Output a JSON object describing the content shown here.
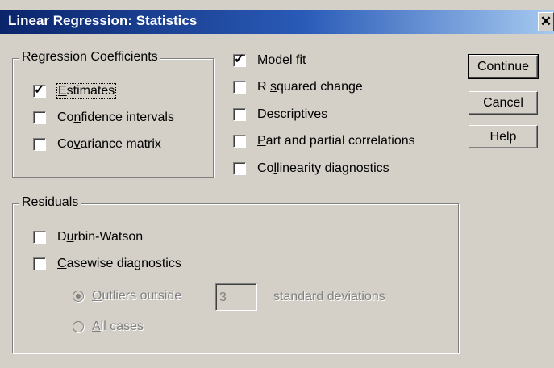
{
  "window": {
    "title": "Linear Regression: Statistics",
    "close_glyph": "✕"
  },
  "regression_coefficients": {
    "label": "Regression Coefficients",
    "estimates": {
      "pre": "",
      "u": "E",
      "post": "stimates",
      "checked": true
    },
    "confidence_intervals": {
      "pre": "Co",
      "u": "n",
      "post": "fidence intervals",
      "checked": false
    },
    "covariance_matrix": {
      "pre": "Co",
      "u": "v",
      "post": "ariance matrix",
      "checked": false
    }
  },
  "model_options": {
    "model_fit": {
      "pre": "",
      "u": "M",
      "post": "odel fit",
      "checked": true
    },
    "r_squared_change": {
      "pre": "R ",
      "u": "s",
      "post": "quared change",
      "checked": false
    },
    "descriptives": {
      "pre": "",
      "u": "D",
      "post": "escriptives",
      "checked": false
    },
    "part_partial": {
      "pre": "",
      "u": "P",
      "post": "art and partial correlations",
      "checked": false
    },
    "collinearity": {
      "pre": "Co",
      "u": "l",
      "post": "linearity diagnostics",
      "checked": false
    }
  },
  "buttons": {
    "continue": "Continue",
    "cancel": "Cancel",
    "help": "Help"
  },
  "residuals": {
    "label": "Residuals",
    "durbin_watson": {
      "pre": "D",
      "u": "u",
      "post": "rbin-Watson",
      "checked": false
    },
    "casewise": {
      "pre": "",
      "u": "C",
      "post": "asewise diagnostics",
      "checked": false
    },
    "outliers_outside": {
      "pre": "",
      "u": "O",
      "post": "utliers outside",
      "selected": true
    },
    "outlier_value": "3",
    "std_dev_label": "standard deviations",
    "all_cases": {
      "pre": "",
      "u": "A",
      "post": "ll cases",
      "selected": false
    }
  },
  "colors": {
    "title_bar_start": "#0a246a",
    "title_bar_end": "#a6caf0",
    "dialog_face": "#d4d0c8",
    "disabled_text": "#808080"
  }
}
